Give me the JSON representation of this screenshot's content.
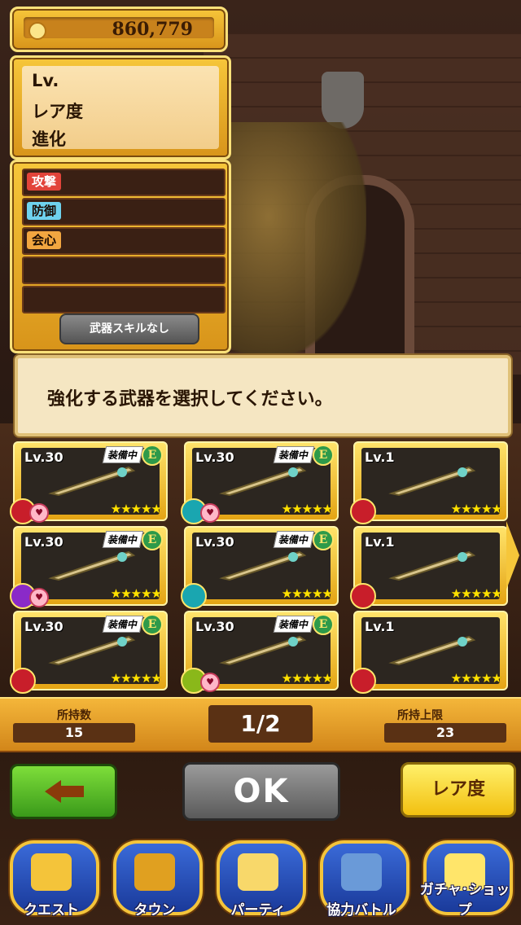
{
  "header": {
    "coins": "860,779"
  },
  "info": {
    "lv_label": "Lv.",
    "rarity_label": "レア度",
    "evolution_label": "進化"
  },
  "stats": {
    "attack": "攻撃",
    "defense": "防御",
    "critical": "会心",
    "skill_button": "武器スキルなし"
  },
  "message": "強化する武器を選択してください。",
  "equip_tag": "装備中",
  "equip_mark": "E",
  "weapons": [
    {
      "level": "Lv.30",
      "equipped": true,
      "stars": "★★★★★",
      "element_color": "#c81e2a",
      "heart": true
    },
    {
      "level": "Lv.30",
      "equipped": true,
      "stars": "★★★★★",
      "element_color": "#1aa6b0",
      "heart": true
    },
    {
      "level": "Lv.1",
      "equipped": false,
      "stars": "★★★★★",
      "element_color": "#c81e2a",
      "heart": false
    },
    {
      "level": "Lv.30",
      "equipped": true,
      "stars": "★★★★★",
      "element_color": "#8a2ac8",
      "heart": true
    },
    {
      "level": "Lv.30",
      "equipped": true,
      "stars": "★★★★★",
      "element_color": "#1aa6b0",
      "heart": false
    },
    {
      "level": "Lv.1",
      "equipped": false,
      "stars": "★★★★★",
      "element_color": "#c81e2a",
      "heart": false
    },
    {
      "level": "Lv.30",
      "equipped": true,
      "stars": "★★★★★",
      "element_color": "#c81e2a",
      "heart": false
    },
    {
      "level": "Lv.30",
      "equipped": true,
      "stars": "★★★★★",
      "element_color": "#8ab81a",
      "heart": true
    },
    {
      "level": "Lv.1",
      "equipped": false,
      "stars": "★★★★★",
      "element_color": "#c81e2a",
      "heart": false
    }
  ],
  "counts": {
    "owned_label": "所持数",
    "owned_value": "15",
    "page": "1/2",
    "limit_label": "所持上限",
    "limit_value": "23"
  },
  "buttons": {
    "ok": "OK",
    "rarity_sort": "レア度"
  },
  "nav": [
    {
      "label": "クエスト",
      "icon": "quest-map-icon"
    },
    {
      "label": "タウン",
      "icon": "town-icon"
    },
    {
      "label": "パーティ",
      "icon": "party-icon"
    },
    {
      "label": "協力バトル",
      "icon": "coop-battle-icon"
    },
    {
      "label": "ガチャ･ショップ",
      "icon": "gacha-shop-icon"
    }
  ]
}
